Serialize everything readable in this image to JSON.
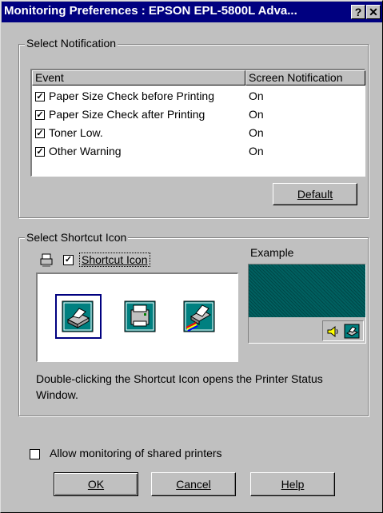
{
  "window": {
    "title": "Monitoring Preferences : EPSON EPL-5800L Adva...",
    "help_button": "?",
    "close_button": "✕"
  },
  "notification_group": {
    "label": "Select Notification",
    "columns": [
      "Event",
      "Screen Notification"
    ],
    "rows": [
      {
        "checked": true,
        "event": "Paper Size Check before Printing",
        "notification": "On"
      },
      {
        "checked": true,
        "event": "Paper Size Check after Printing",
        "notification": "On"
      },
      {
        "checked": true,
        "event": "Toner Low.",
        "notification": "On"
      },
      {
        "checked": true,
        "event": "Other Warning",
        "notification": "On"
      }
    ],
    "default_button": "Default"
  },
  "shortcut_group": {
    "label": "Select Shortcut Icon",
    "checkbox_label": "Shortcut Icon",
    "checkbox_checked": true,
    "example_label": "Example",
    "selected_icon_index": 0,
    "icons": [
      "printer-icon-style-1",
      "printer-icon-style-2",
      "printer-icon-style-3"
    ],
    "description": "Double-clicking the Shortcut Icon opens the Printer Status Window."
  },
  "footer": {
    "shared_monitoring_label": "Allow monitoring of shared printers",
    "shared_monitoring_checked": false,
    "ok_button": "OK",
    "cancel_button": "Cancel",
    "help_button": "Help"
  },
  "colors": {
    "titlebar": "#000080",
    "face": "#c0c0c0",
    "desktop": "#006060"
  }
}
